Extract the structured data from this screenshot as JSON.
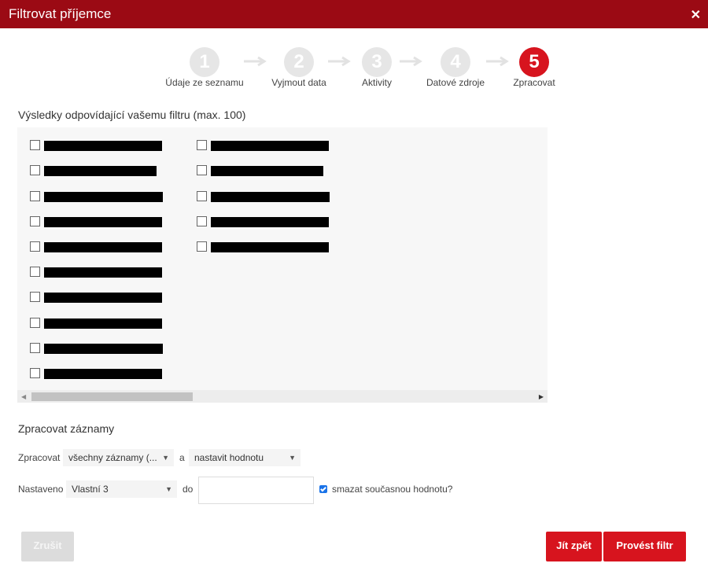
{
  "dialog": {
    "title": "Filtrovat příjemce"
  },
  "wizard": {
    "steps": [
      {
        "number": "1",
        "label": "Údaje ze seznamu",
        "active": false
      },
      {
        "number": "2",
        "label": "Vyjmout data",
        "active": false
      },
      {
        "number": "3",
        "label": "Aktivity",
        "active": false
      },
      {
        "number": "4",
        "label": "Datové zdroje",
        "active": false
      },
      {
        "number": "5",
        "label": "Zpracovat",
        "active": true
      }
    ]
  },
  "results": {
    "title": "Výsledky odpovídající vašemu filtru (max. 100)",
    "item_count": 15
  },
  "process": {
    "title": "Zpracovat záznamy",
    "row1": {
      "label": "Zpracovat",
      "scope_value": "všechny záznamy (...",
      "connector": "a",
      "action_value": "nastavit hodnotu"
    },
    "row2": {
      "label": "Nastaveno",
      "field_value": "Vlastní 3",
      "connector": "do",
      "value_input": "",
      "clear_label": "smazat současnou hodnotu?",
      "clear_checked": true
    }
  },
  "buttons": {
    "cancel": "Zrušit",
    "back": "Jít zpět",
    "run": "Provést filtr"
  },
  "colors": {
    "header": "#9b0a14",
    "accent": "#d7141e",
    "step_inactive": "#e6e6e6"
  }
}
